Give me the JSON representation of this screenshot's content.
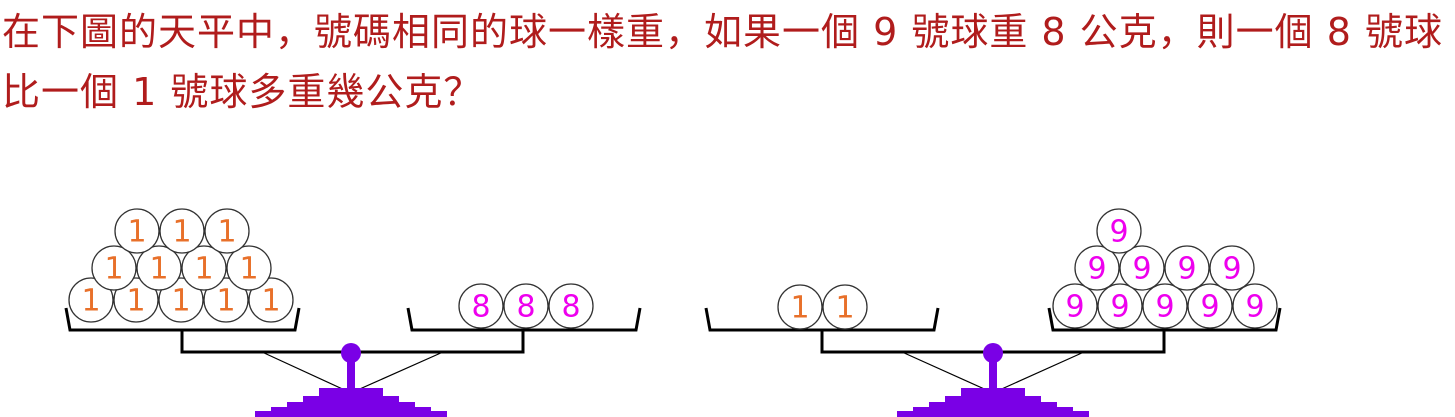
{
  "question": "在下圖的天平中，號碼相同的球一樣重，如果一個 9 號球重 8 公克，則一個 8 號球比一個 1 號球多重幾公克？",
  "colors": {
    "question_text": "#b01c1c",
    "ball_1_label": "#e8702a",
    "ball_8_label": "#ee00ee",
    "ball_9_label": "#ee00ee",
    "base": "#7a00e6",
    "frame": "#000000"
  },
  "scales": [
    {
      "name": "left-scale",
      "tilt": "level",
      "left_pan": {
        "balls": [
          {
            "label": "1",
            "count": 12
          }
        ]
      },
      "right_pan": {
        "balls": [
          {
            "label": "8",
            "count": 3
          }
        ]
      }
    },
    {
      "name": "right-scale",
      "tilt": "level",
      "left_pan": {
        "balls": [
          {
            "label": "1",
            "count": 2
          }
        ]
      },
      "right_pan": {
        "balls": [
          {
            "label": "9",
            "count": 10
          }
        ]
      }
    }
  ]
}
